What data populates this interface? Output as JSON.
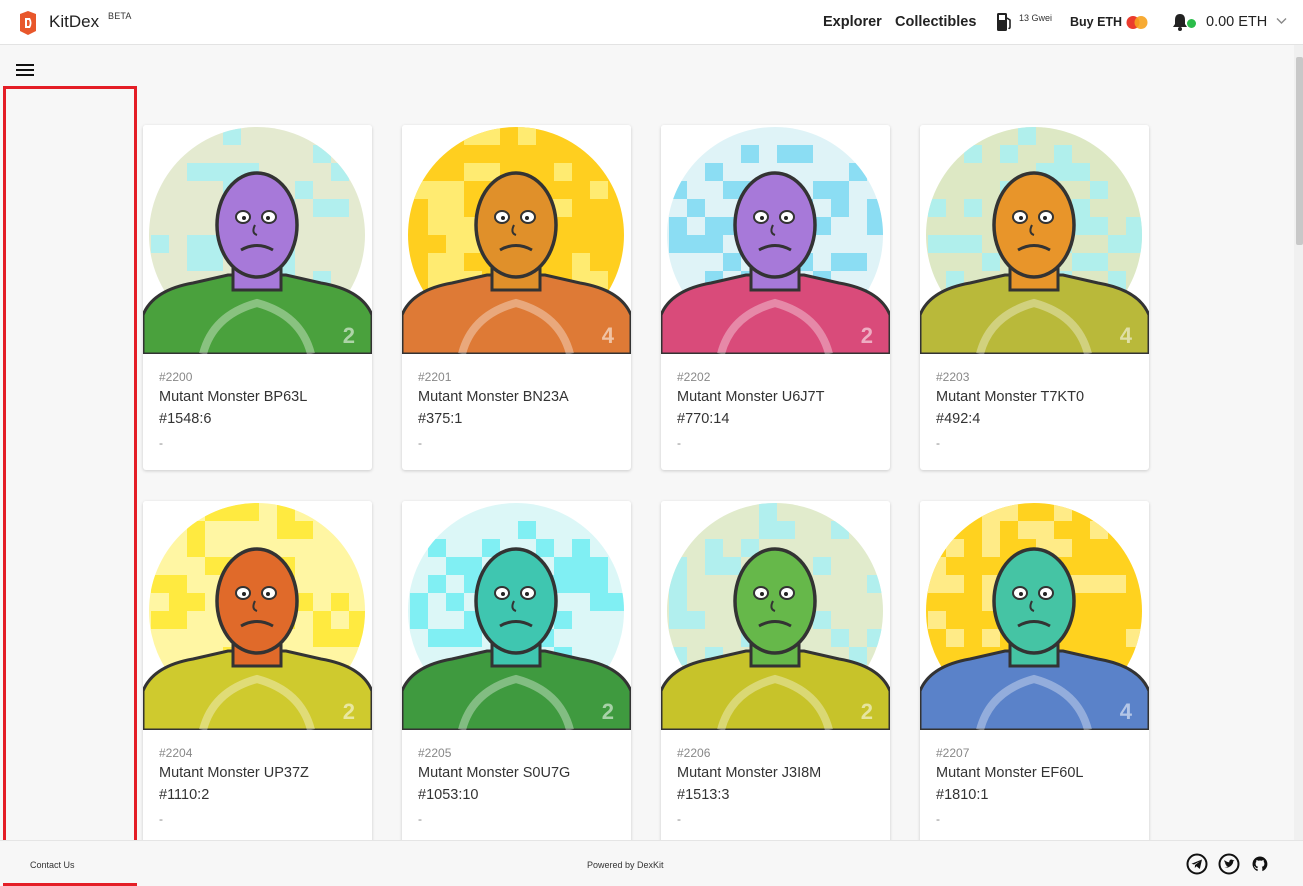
{
  "header": {
    "brand": "KitDex",
    "beta": "BETA",
    "nav_explorer": "Explorer",
    "nav_collectibles": "Collectibles",
    "gas": "13 Gwei",
    "buy_eth": "Buy ETH",
    "balance": "0.00 ETH"
  },
  "colors": {
    "brand_orange": "#e8572b",
    "highlight_red": "#e41e26",
    "status_green": "#2bbd4a"
  },
  "cards": [
    {
      "number": "#2200",
      "name": "Mutant Monster BP63L",
      "sub": "#1548:6",
      "dash": "-",
      "bg": "#e4ead0",
      "pix": "#a8f0f4",
      "face": "#a779d9",
      "body": "#4aa13d",
      "num": "2"
    },
    {
      "number": "#2201",
      "name": "Mutant Monster BN23A",
      "sub": "#375:1",
      "dash": "-",
      "bg": "#ffcf1f",
      "pix": "#fff080",
      "face": "#e0902a",
      "body": "#de7a36",
      "num": "4"
    },
    {
      "number": "#2202",
      "name": "Mutant Monster U6J7T",
      "sub": "#770:14",
      "dash": "-",
      "bg": "#dff3f7",
      "pix": "#7dd9f2",
      "face": "#a779d9",
      "body": "#d94b7a",
      "num": "2"
    },
    {
      "number": "#2203",
      "name": "Mutant Monster T7KT0",
      "sub": "#492:4",
      "dash": "-",
      "bg": "#dde8c4",
      "pix": "#a8f0f4",
      "face": "#e8952a",
      "body": "#b9b93a",
      "num": "4"
    },
    {
      "number": "#2204",
      "name": "Mutant Monster UP37Z",
      "sub": "#1110:2",
      "dash": "-",
      "bg": "#fff6a3",
      "pix": "#ffe830",
      "face": "#e06a2a",
      "body": "#cfca2e",
      "num": "2"
    },
    {
      "number": "#2205",
      "name": "Mutant Monster S0U7G",
      "sub": "#1053:10",
      "dash": "-",
      "bg": "#dcf7f7",
      "pix": "#70eef2",
      "face": "#3fc6b0",
      "body": "#3f9a3f",
      "num": "2"
    },
    {
      "number": "#2206",
      "name": "Mutant Monster J3I8M",
      "sub": "#1513:3",
      "dash": "-",
      "bg": "#e1ebcc",
      "pix": "#a8f0f4",
      "face": "#66b84a",
      "body": "#c7c32a",
      "num": "2"
    },
    {
      "number": "#2207",
      "name": "Mutant Monster EF60L",
      "sub": "#1810:1",
      "dash": "-",
      "bg": "#ffd21f",
      "pix": "#fff09a",
      "face": "#45c4a4",
      "body": "#5a82c9",
      "num": "4"
    }
  ],
  "footer": {
    "contact": "Contact Us",
    "powered": "Powered by DexKit"
  }
}
